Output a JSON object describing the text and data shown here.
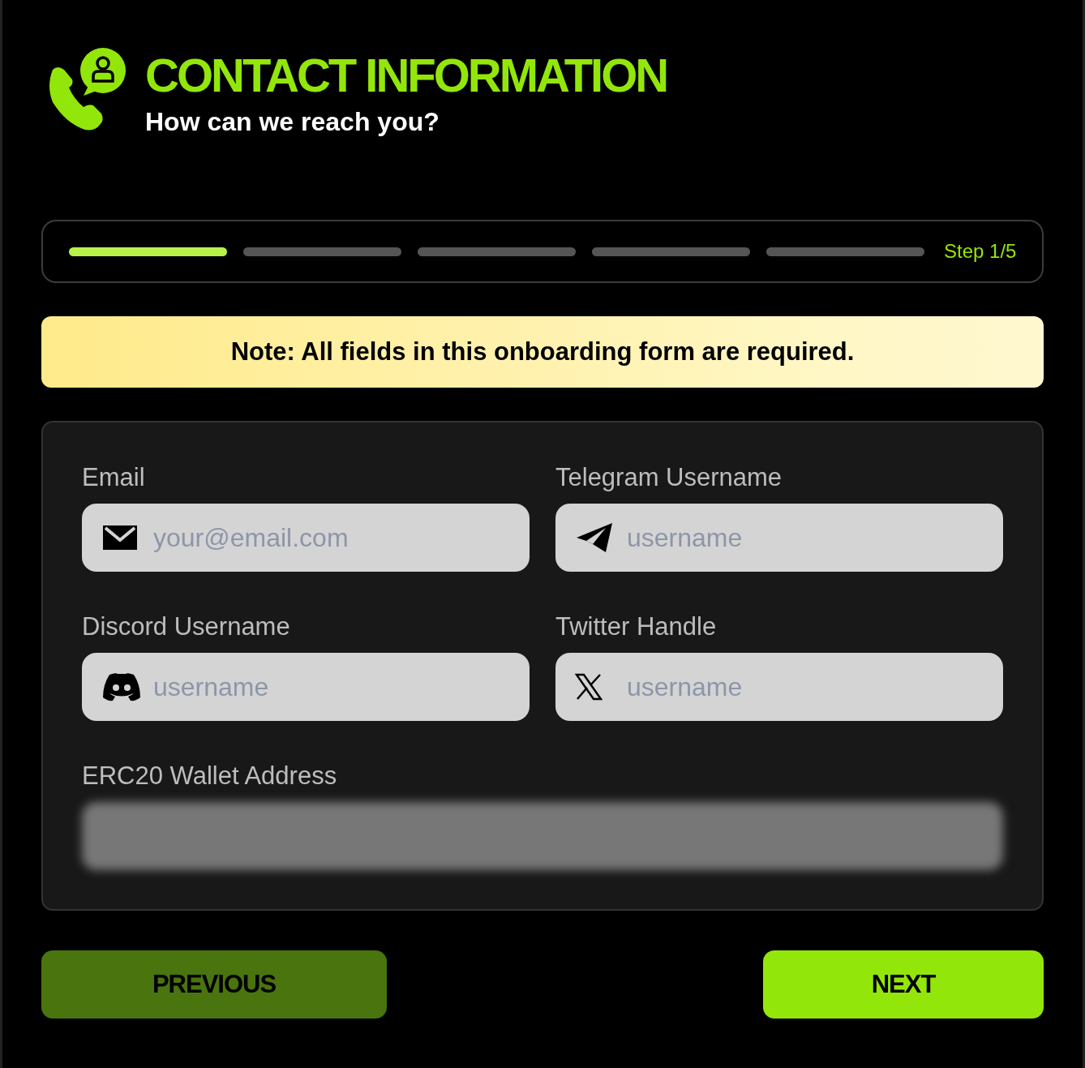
{
  "header": {
    "title": "CONTACT INFORMATION",
    "subtitle": "How can we reach you?"
  },
  "progress": {
    "steps": [
      {
        "completed": true
      },
      {
        "completed": false
      },
      {
        "completed": false
      },
      {
        "completed": false
      },
      {
        "completed": false
      }
    ],
    "label": "Step 1/5"
  },
  "note": "Note: All fields in this onboarding form are required.",
  "fields": [
    {
      "kind": "email",
      "label": "Email",
      "placeholder": "your@email.com"
    },
    {
      "kind": "telegram",
      "label": "Telegram Username",
      "placeholder": "username"
    },
    {
      "kind": "discord",
      "label": "Discord Username",
      "placeholder": "username"
    },
    {
      "kind": "twitter",
      "label": "Twitter Handle",
      "placeholder": "username"
    },
    {
      "kind": "wallet",
      "label": "ERC20 Wallet Address",
      "obscured": true
    }
  ],
  "buttons": [
    {
      "kind": "secondary",
      "label": "PREVIOUS"
    },
    {
      "kind": "primary",
      "label": "NEXT"
    }
  ]
}
